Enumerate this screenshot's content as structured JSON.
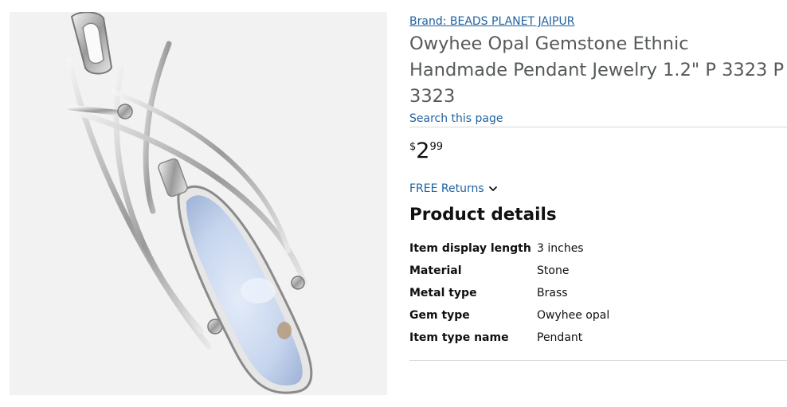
{
  "product": {
    "brand_label": "Brand: BEADS PLANET JAIPUR",
    "title": "Owyhee Opal Gemstone Ethnic Handmade Pendant Jewelry 1.2\" P 3323 P 3323",
    "search_link": "Search this page",
    "price": {
      "symbol": "$",
      "whole": "2",
      "fraction": "99"
    },
    "returns_label": "FREE Returns",
    "image_icon": "pendant-product-image"
  },
  "details": {
    "heading": "Product details",
    "rows": [
      {
        "key": "Item display length",
        "value": "3 inches"
      },
      {
        "key": "Material",
        "value": "Stone"
      },
      {
        "key": "Metal type",
        "value": "Brass"
      },
      {
        "key": "Gem type",
        "value": "Owyhee opal"
      },
      {
        "key": "Item type name",
        "value": "Pendant"
      }
    ]
  },
  "colors": {
    "link": "#2162a1",
    "title": "#565959",
    "text": "#0f1111",
    "image_bg": "#f2f2f2",
    "stone": "#c4d3ec",
    "silver": "#b8b8b8"
  }
}
